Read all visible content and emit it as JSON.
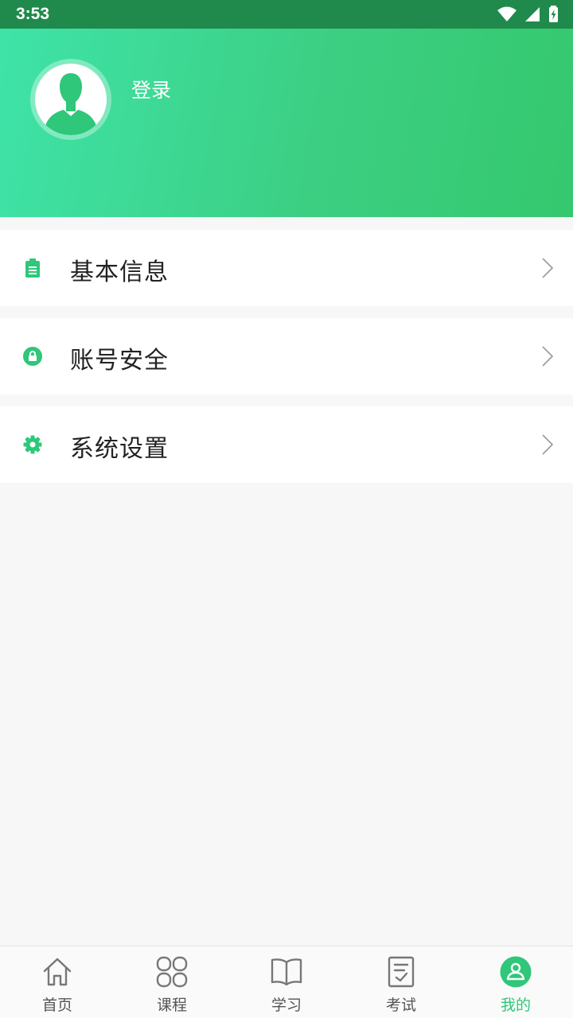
{
  "status_bar": {
    "time": "3:53"
  },
  "header": {
    "login_label": "登录"
  },
  "menu": [
    {
      "label": "基本信息",
      "icon": "clipboard-icon"
    },
    {
      "label": "账号安全",
      "icon": "lock-icon"
    },
    {
      "label": "系统设置",
      "icon": "gear-icon"
    }
  ],
  "bottom_nav": [
    {
      "label": "首页",
      "icon": "home-icon"
    },
    {
      "label": "课程",
      "icon": "grid-icon"
    },
    {
      "label": "学习",
      "icon": "book-icon"
    },
    {
      "label": "考试",
      "icon": "exam-icon"
    },
    {
      "label": "我的",
      "icon": "user-icon",
      "active": true
    }
  ],
  "colors": {
    "accent": "#2fc779",
    "header_start": "#3fe3a8",
    "header_end": "#35c86e",
    "status_bar": "#1f8a4c"
  }
}
